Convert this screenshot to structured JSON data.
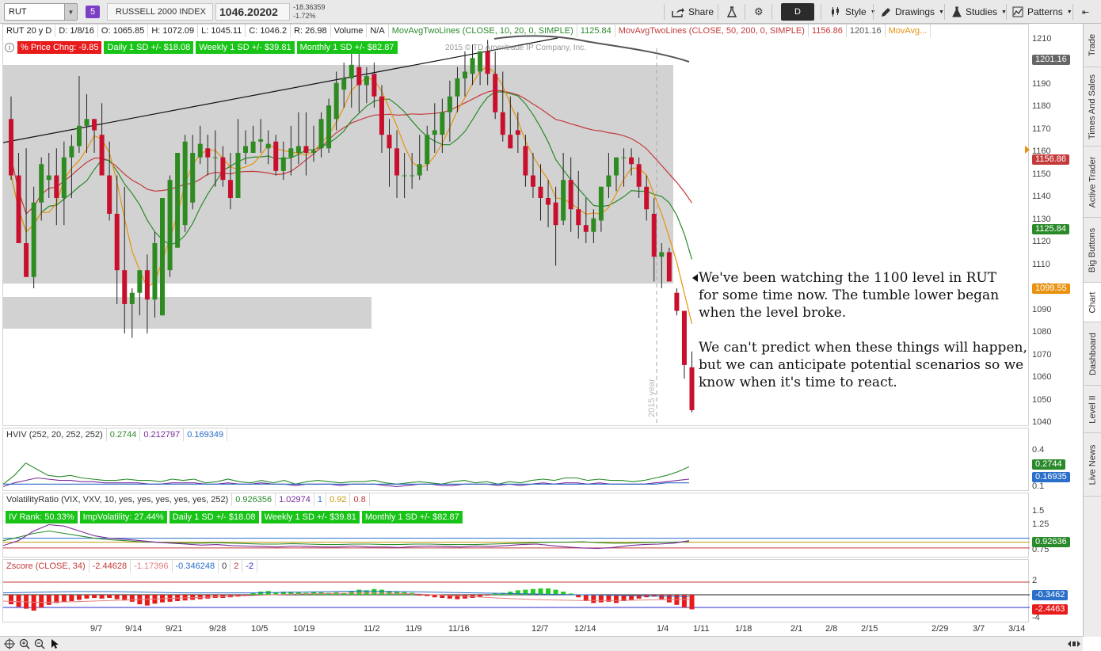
{
  "toolbar": {
    "symbol": "RUT",
    "badge": "5",
    "index_name": "RUSSELL 2000 INDEX",
    "price": "1046.20202",
    "change": "-18.36359",
    "change_pct": "-1.72%",
    "share": "Share",
    "period": "D",
    "style": "Style",
    "drawings": "Drawings",
    "studies": "Studies",
    "patterns": "Patterns"
  },
  "side_tabs": [
    "Trade",
    "Times And Sales",
    "Active Trader",
    "Big Buttons",
    "Chart",
    "Dashboard",
    "Level II",
    "Live News"
  ],
  "price_header": {
    "symbol": "RUT 20 y D",
    "date": "D: 1/8/16",
    "open": "O: 1065.85",
    "high": "H: 1072.09",
    "low": "L: 1045.11",
    "close": "C: 1046.2",
    "range": "R: 26.98",
    "volume": "Volume",
    "na": "N/A",
    "ma1": "MovAvgTwoLines (CLOSE, 10, 20, 0, SIMPLE)",
    "ma1_val": "1125.84",
    "ma2": "MovAvgTwoLines (CLOSE, 50, 200, 0, SIMPLE)",
    "ma2_val1": "1156.86",
    "ma2_val2": "1201.16",
    "ma3": "MovAvg..."
  },
  "price_labels": {
    "pct_change": "% Price Chng: -9.85",
    "daily_sd": "Daily 1 SD +/- $18.08",
    "weekly_sd": "Weekly 1 SD +/- $39.81",
    "monthly_sd": "Monthly 1 SD +/- $82.87",
    "copyright": "2015 © TD Ameritrade IP Company, Inc.",
    "year_marker": "2015 year"
  },
  "annotation": {
    "para1": [
      "We've been watching the 1100 level in RUT",
      "for some time now.  The tumble lower began",
      "when the level broke."
    ],
    "para2": [
      "We can't predict when these things will happen,",
      "but we can anticipate potential scenarios so we",
      "know when it's time to react."
    ]
  },
  "hviv_header": {
    "name": "HVIV (252, 20, 252, 252)",
    "v1": "0.2744",
    "v2": "0.212797",
    "v3": "0.169349"
  },
  "vr_header": {
    "name": "VolatilityRatio (VIX, VXV, 10, yes, yes, yes, yes, yes, 252)",
    "v1": "0.926356",
    "v2": "1.02974",
    "v3": "1",
    "v4": "0.92",
    "v5": "0.8"
  },
  "vr_labels": {
    "rank": "IV Rank: 50.33%",
    "impvol": "ImpVolatility: 27.44%",
    "daily": "Daily 1 SD +/- $18.08",
    "weekly": "Weekly 1 SD +/- $39.81",
    "monthly": "Monthly 1 SD +/- $82.87"
  },
  "z_header": {
    "name": "Zscore (CLOSE, 34)",
    "v1": "-2.44628",
    "v2": "-1.17396",
    "v3": "-0.346248",
    "v4": "0",
    "v5": "2",
    "v6": "-2"
  },
  "price_axis": {
    "ticks": [
      "1210",
      "1200",
      "1190",
      "1180",
      "1170",
      "1160",
      "1150",
      "1140",
      "1130",
      "1120",
      "1110",
      "1100",
      "1090",
      "1080",
      "1070",
      "1060",
      "1050",
      "1040"
    ],
    "badges": [
      {
        "text": "1201.16",
        "color": "#666666"
      },
      {
        "text": "1156.86",
        "color": "#c43a3a"
      },
      {
        "text": "1125.84",
        "color": "#2a8a2a"
      },
      {
        "text": "1099.55",
        "color": "#e8920f"
      }
    ]
  },
  "hviv_axis": {
    "ticks": [
      "0.4",
      "0.1"
    ],
    "badges": [
      {
        "text": "0.2744",
        "color": "#2a8a2a"
      },
      {
        "text": "0.16935",
        "color": "#2a6fc9"
      }
    ]
  },
  "vr_axis": {
    "ticks": [
      "1.5",
      "1.25",
      "0.75"
    ],
    "badges": [
      {
        "text": "0.92636",
        "color": "#2a8a2a"
      }
    ]
  },
  "z_axis": {
    "ticks": [
      "2",
      "-4"
    ],
    "badges": [
      {
        "text": "-0.3462",
        "color": "#2a6fc9"
      },
      {
        "text": "-2.4463",
        "color": "#e81b1b"
      }
    ]
  },
  "x_axis": [
    "9/7",
    "9/14",
    "9/21",
    "9/28",
    "10/5",
    "10/19",
    "11/2",
    "11/9",
    "11/16",
    "12/7",
    "12/14",
    "1/4",
    "1/11",
    "1/18",
    "2/1",
    "2/8",
    "2/15",
    "2/29",
    "3/7",
    "3/14"
  ],
  "colors": {
    "up": "#2e8b22",
    "down": "#c8102e",
    "ma10": "#e8920f",
    "ma20": "#2a8a2a",
    "ma50": "#c43a3a",
    "ma200": "#555555"
  },
  "chart_data": [
    {
      "type": "candlestick",
      "title": "RUT 20 y D",
      "ylim": [
        1040,
        1215
      ],
      "dates": [
        "8/31",
        "9/1",
        "9/2",
        "9/3",
        "9/4",
        "9/8",
        "9/9",
        "9/10",
        "9/11",
        "9/14",
        "9/15",
        "9/16",
        "9/17",
        "9/18",
        "9/21",
        "9/22",
        "9/23",
        "9/24",
        "9/25",
        "9/28",
        "9/29",
        "9/30",
        "10/1",
        "10/2",
        "10/5",
        "10/6",
        "10/7",
        "10/8",
        "10/9",
        "10/12",
        "10/13",
        "10/14",
        "10/15",
        "10/16",
        "10/19",
        "10/20",
        "10/21",
        "10/22",
        "10/23",
        "10/26",
        "10/27",
        "10/28",
        "10/29",
        "10/30",
        "11/2",
        "11/3",
        "11/4",
        "11/5",
        "11/6",
        "11/9",
        "11/10",
        "11/11",
        "11/12",
        "11/13",
        "11/16",
        "11/17",
        "11/18",
        "11/19",
        "11/20",
        "11/23",
        "11/24",
        "11/25",
        "11/27",
        "11/30",
        "12/1",
        "12/2",
        "12/3",
        "12/4",
        "12/7",
        "12/8",
        "12/9",
        "12/10",
        "12/11",
        "12/14",
        "12/15",
        "12/16",
        "12/17",
        "12/18",
        "12/21",
        "12/22",
        "12/23",
        "12/24",
        "12/28",
        "12/29",
        "12/30",
        "12/31",
        "1/4",
        "1/5",
        "1/6",
        "1/7",
        "1/8"
      ],
      "open": [
        1175,
        1150,
        1120,
        1105,
        1138,
        1148,
        1150,
        1140,
        1158,
        1163,
        1172,
        1175,
        1168,
        1150,
        1133,
        1108,
        1093,
        1098,
        1108,
        1095,
        1088,
        1108,
        1118,
        1128,
        1138,
        1158,
        1162,
        1158,
        1158,
        1148,
        1140,
        1160,
        1160,
        1165,
        1162,
        1165,
        1152,
        1158,
        1160,
        1163,
        1160,
        1162,
        1162,
        1175,
        1188,
        1193,
        1198,
        1190,
        1195,
        1185,
        1168,
        1162,
        1150,
        1150,
        1150,
        1155,
        1168,
        1168,
        1178,
        1185,
        1193,
        1195,
        1196,
        1205,
        1195,
        1178,
        1168,
        1170,
        1163,
        1150,
        1145,
        1140,
        1138,
        1130,
        1148,
        1135,
        1128,
        1125,
        1130,
        1145,
        1150,
        1158,
        1158,
        1155,
        1145,
        1133,
        1114,
        1116,
        1098,
        1090,
        1065
      ],
      "high": [
        1185,
        1160,
        1162,
        1145,
        1158,
        1160,
        1162,
        1165,
        1168,
        1194,
        1186,
        1175,
        1182,
        1165,
        1150,
        1145,
        1100,
        1108,
        1115,
        1125,
        1140,
        1150,
        1160,
        1168,
        1168,
        1172,
        1168,
        1170,
        1163,
        1160,
        1175,
        1170,
        1172,
        1175,
        1170,
        1168,
        1165,
        1172,
        1178,
        1178,
        1172,
        1178,
        1184,
        1196,
        1200,
        1205,
        1205,
        1198,
        1200,
        1190,
        1175,
        1170,
        1160,
        1160,
        1168,
        1172,
        1182,
        1184,
        1192,
        1198,
        1205,
        1208,
        1205,
        1210,
        1205,
        1196,
        1185,
        1178,
        1168,
        1160,
        1155,
        1148,
        1145,
        1160,
        1158,
        1152,
        1140,
        1135,
        1145,
        1160,
        1155,
        1162,
        1162,
        1158,
        1150,
        1140,
        1120,
        1118,
        1100,
        1072,
        1072
      ],
      "low": [
        1148,
        1130,
        1105,
        1100,
        1130,
        1140,
        1128,
        1128,
        1140,
        1160,
        1160,
        1160,
        1150,
        1130,
        1093,
        1080,
        1078,
        1088,
        1080,
        1087,
        1088,
        1105,
        1118,
        1125,
        1135,
        1155,
        1150,
        1145,
        1145,
        1135,
        1140,
        1155,
        1160,
        1160,
        1155,
        1150,
        1148,
        1150,
        1155,
        1150,
        1156,
        1158,
        1160,
        1170,
        1180,
        1180,
        1178,
        1182,
        1180,
        1160,
        1145,
        1140,
        1140,
        1144,
        1148,
        1152,
        1160,
        1160,
        1165,
        1178,
        1185,
        1190,
        1190,
        1190,
        1175,
        1165,
        1162,
        1160,
        1145,
        1140,
        1130,
        1127,
        1110,
        1128,
        1125,
        1122,
        1120,
        1120,
        1125,
        1140,
        1143,
        1145,
        1150,
        1140,
        1130,
        1103,
        1100,
        1105,
        1088,
        1060,
        1045
      ],
      "close": [
        1150,
        1120,
        1105,
        1138,
        1155,
        1150,
        1140,
        1158,
        1163,
        1172,
        1175,
        1170,
        1150,
        1133,
        1108,
        1093,
        1098,
        1108,
        1095,
        1120,
        1140,
        1148,
        1160,
        1165,
        1160,
        1164,
        1158,
        1158,
        1148,
        1140,
        1160,
        1163,
        1165,
        1166,
        1164,
        1152,
        1158,
        1162,
        1163,
        1160,
        1161,
        1175,
        1181,
        1191,
        1193,
        1199,
        1190,
        1194,
        1185,
        1168,
        1162,
        1150,
        1150,
        1150,
        1155,
        1168,
        1170,
        1178,
        1185,
        1193,
        1196,
        1202,
        1205,
        1195,
        1178,
        1168,
        1162,
        1168,
        1150,
        1145,
        1140,
        1137,
        1128,
        1148,
        1135,
        1128,
        1125,
        1131,
        1145,
        1150,
        1158,
        1158,
        1155,
        1145,
        1135,
        1114,
        1116,
        1103,
        1090,
        1066,
        1046
      ]
    },
    {
      "type": "line",
      "title": "HVIV (252, 20, 252, 252)",
      "ylim": [
        0.1,
        0.4
      ],
      "series": [
        {
          "name": "0.2744",
          "values": [
            0.13,
            0.2,
            0.3,
            0.25,
            0.2,
            0.19,
            0.2,
            0.18,
            0.17,
            0.16,
            0.16,
            0.17,
            0.16,
            0.16,
            0.15,
            0.17,
            0.16,
            0.17,
            0.14,
            0.15,
            0.17,
            0.15,
            0.14,
            0.16,
            0.14,
            0.16,
            0.13,
            0.15,
            0.16,
            0.15,
            0.14,
            0.15,
            0.15,
            0.16,
            0.14,
            0.13,
            0.14,
            0.15,
            0.14,
            0.13,
            0.15,
            0.16,
            0.14,
            0.15,
            0.13,
            0.15,
            0.14,
            0.16,
            0.17,
            0.16,
            0.18,
            0.18,
            0.16,
            0.17,
            0.16,
            0.16,
            0.15,
            0.16,
            0.18,
            0.2,
            0.23,
            0.27
          ]
        },
        {
          "name": "0.212797",
          "values": [
            0.11,
            0.14,
            0.16,
            0.18,
            0.17,
            0.16,
            0.16,
            0.15,
            0.15,
            0.14,
            0.14,
            0.14,
            0.14,
            0.13,
            0.13,
            0.14,
            0.14,
            0.14,
            0.13,
            0.13,
            0.14,
            0.13,
            0.13,
            0.14,
            0.13,
            0.13,
            0.12,
            0.13,
            0.13,
            0.13,
            0.12,
            0.13,
            0.13,
            0.13,
            0.12,
            0.11,
            0.12,
            0.13,
            0.13,
            0.12,
            0.12,
            0.13,
            0.13,
            0.13,
            0.12,
            0.13,
            0.12,
            0.13,
            0.14,
            0.13,
            0.14,
            0.14,
            0.13,
            0.14,
            0.13,
            0.13,
            0.13,
            0.13,
            0.14,
            0.15,
            0.16,
            0.17
          ]
        },
        {
          "name": "0.169349",
          "values": [
            0.13,
            0.13,
            0.13,
            0.13,
            0.13,
            0.13,
            0.13,
            0.13,
            0.13,
            0.13,
            0.13,
            0.13,
            0.13,
            0.13,
            0.13,
            0.13,
            0.13,
            0.13,
            0.13,
            0.13,
            0.13,
            0.13,
            0.13,
            0.13,
            0.13,
            0.13,
            0.13,
            0.13,
            0.13,
            0.13,
            0.13,
            0.13,
            0.13,
            0.13,
            0.13,
            0.13,
            0.13,
            0.13,
            0.13,
            0.13,
            0.13,
            0.13,
            0.13,
            0.13,
            0.13,
            0.13,
            0.13,
            0.13,
            0.13,
            0.13,
            0.13,
            0.13,
            0.13,
            0.13,
            0.13,
            0.13,
            0.13,
            0.13,
            0.13,
            0.14,
            0.14,
            0.14
          ]
        }
      ]
    },
    {
      "type": "line",
      "title": "VolatilityRatio (VIX, VXV, 10, yes, yes, yes, yes, yes, 252)",
      "ylim": [
        0.7,
        1.6
      ],
      "series": [
        {
          "name": "0.926356",
          "values": [
            0.95,
            1.02,
            1.1,
            1.15,
            1.1,
            1.05,
            1.0,
            0.97,
            0.95,
            0.93,
            0.92,
            0.91,
            0.9,
            0.9,
            0.91,
            0.9,
            0.89,
            0.88,
            0.88,
            0.89,
            0.88,
            0.87,
            0.87,
            0.88,
            0.88,
            0.87,
            0.87,
            0.88,
            0.88,
            0.87,
            0.87,
            0.87,
            0.88,
            0.89,
            0.9,
            0.91,
            0.92,
            0.92,
            0.93,
            0.91,
            0.9,
            0.9,
            0.91,
            0.92,
            0.92,
            0.93
          ]
        },
        {
          "name": "1.02974",
          "values": [
            0.85,
            0.95,
            1.15,
            1.28,
            1.25,
            1.15,
            1.05,
            1.0,
            0.98,
            0.95,
            0.92,
            0.9,
            0.88,
            0.86,
            0.87,
            0.85,
            0.84,
            0.83,
            0.82,
            0.84,
            0.83,
            0.82,
            0.82,
            0.84,
            0.82,
            0.82,
            0.81,
            0.83,
            0.84,
            0.83,
            0.82,
            0.84,
            0.83,
            0.85,
            0.87,
            0.88,
            0.85,
            0.82,
            0.8,
            0.79,
            0.81,
            0.85,
            0.87,
            0.88,
            0.9,
            0.95
          ]
        }
      ],
      "reference_lines": [
        1,
        0.92,
        0.8
      ]
    },
    {
      "type": "bar",
      "title": "Zscore (CLOSE, 34)",
      "ylim": [
        -4,
        2
      ],
      "values": [
        -1.5,
        -1.9,
        -2.2,
        -2.5,
        -2.0,
        -1.6,
        -1.3,
        -1.1,
        -1.0,
        -0.8,
        -0.6,
        -0.5,
        -0.6,
        -0.5,
        -0.7,
        -0.9,
        -1.1,
        -1.5,
        -1.7,
        -1.4,
        -1.2,
        -1.1,
        -1.0,
        -0.9,
        -0.8,
        -0.7,
        -0.6,
        -0.5,
        -0.5,
        -0.4,
        -0.3,
        -0.1,
        0.3,
        0.5,
        0.6,
        0.4,
        0.5,
        0.5,
        0.4,
        0.3,
        0.5,
        0.4,
        0.3,
        0.4,
        0.3,
        0.6,
        0.8,
        0.7,
        0.9,
        0.8,
        0.6,
        0.5,
        0.4,
        0.3,
        -0.1,
        -0.2,
        -0.4,
        -0.5,
        -0.6,
        -0.7,
        -0.6,
        -0.5,
        -0.3,
        -0.1,
        0.2,
        0.3,
        0.5,
        0.7,
        0.8,
        0.9,
        1.0,
        1.0,
        0.8,
        0.5,
        0.2,
        -0.4,
        -1.0,
        -1.3,
        -1.2,
        -1.1,
        -1.3,
        -1.0,
        -0.8,
        -0.6,
        -0.4,
        -0.3,
        -0.7,
        -1.2,
        -1.6,
        -2.0,
        -2.3
      ],
      "series": [
        {
          "name": "-1.17396",
          "values": [
            -1.0,
            -1.2,
            -1.1,
            -0.9,
            -0.7,
            -0.5,
            -0.3,
            -0.1,
            0.1,
            0.2,
            0.3,
            0.2,
            0.0,
            -0.3,
            -0.6,
            -0.8,
            -0.9,
            -0.9,
            -0.8,
            -0.7
          ]
        },
        {
          "name": "-0.346248",
          "values": [
            0.3,
            0.4,
            0.5,
            0.5,
            0.4,
            0.3,
            0.3,
            0.3,
            0.4,
            0.5,
            0.6,
            0.5,
            0.4,
            0.3,
            0.2,
            0.1,
            0.0,
            -0.1,
            -0.2,
            -0.3
          ]
        }
      ],
      "reference_lines": [
        2,
        0,
        -2
      ]
    }
  ]
}
